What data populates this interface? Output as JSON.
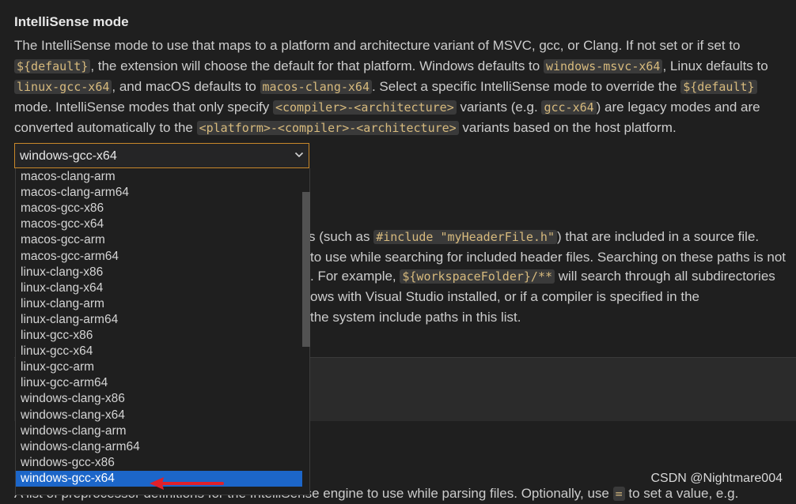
{
  "setting": {
    "title": "IntelliSense mode",
    "desc_lines": [
      [
        {
          "t": "The IntelliSense mode to use that maps to a platform and architecture variant of MSVC, gcc, or Clang. If not set or if set to"
        }
      ],
      [
        {
          "c": "${default}"
        },
        {
          "t": ", the extension will choose the default for that platform. Windows defaults to "
        },
        {
          "c": "windows-msvc-x64"
        },
        {
          "t": ", Linux defaults to"
        }
      ],
      [
        {
          "c": "linux-gcc-x64"
        },
        {
          "t": ", and macOS defaults to "
        },
        {
          "c": "macos-clang-x64"
        },
        {
          "t": ". Select a specific IntelliSense mode to override the "
        },
        {
          "c": "${default}"
        }
      ],
      [
        {
          "t": "mode. IntelliSense modes that only specify "
        },
        {
          "c": "<compiler>-<architecture>"
        },
        {
          "t": " variants (e.g. "
        },
        {
          "c": "gcc-x64"
        },
        {
          "t": ") are legacy modes and are"
        }
      ],
      [
        {
          "t": "converted automatically to the "
        },
        {
          "c": "<platform>-<compiler>-<architecture>"
        },
        {
          "t": " variants based on the host platform."
        }
      ]
    ]
  },
  "select": {
    "value": "windows-gcc-x64",
    "options": [
      "macos-clang-arm",
      "macos-clang-arm64",
      "macos-gcc-x86",
      "macos-gcc-x64",
      "macos-gcc-arm",
      "macos-gcc-arm64",
      "linux-clang-x86",
      "linux-clang-x64",
      "linux-clang-arm",
      "linux-clang-arm64",
      "linux-gcc-x86",
      "linux-gcc-x64",
      "linux-gcc-arm",
      "linux-gcc-arm64",
      "windows-clang-x86",
      "windows-clang-x64",
      "windows-clang-arm",
      "windows-clang-arm64",
      "windows-gcc-x86",
      "windows-gcc-x64"
    ],
    "selected": "windows-gcc-x64"
  },
  "background": {
    "lines": [
      [
        {
          "t": "iles (such as "
        },
        {
          "c": "#include \"myHeaderFile.h\""
        },
        {
          "t": ") that are included in a source file."
        }
      ],
      [
        {
          "t": "to use while searching for included header files. Searching on these paths is not"
        }
      ],
      [
        {
          "t": ". For example, "
        },
        {
          "c": "${workspaceFolder}/**"
        },
        {
          "t": " will search through all subdirectories"
        }
      ],
      [
        {
          "t": "ows with Visual Studio installed, or if a compiler is specified in the"
        }
      ],
      [
        {
          "t": "the system include paths in this list."
        }
      ]
    ],
    "bottom_line": [
      {
        "t": "A list of preprocessor definitions for the IntelliSense engine to use while parsing files. Optionally, use "
      },
      {
        "c": "="
      },
      {
        "t": " to set a value, e.g."
      }
    ]
  },
  "watermark": "CSDN @Nightmare004",
  "colors": {
    "accent_border": "#c8882a",
    "selection": "#1c66c9",
    "arrow": "#e0202a",
    "code_text": "#d7ba7d"
  }
}
